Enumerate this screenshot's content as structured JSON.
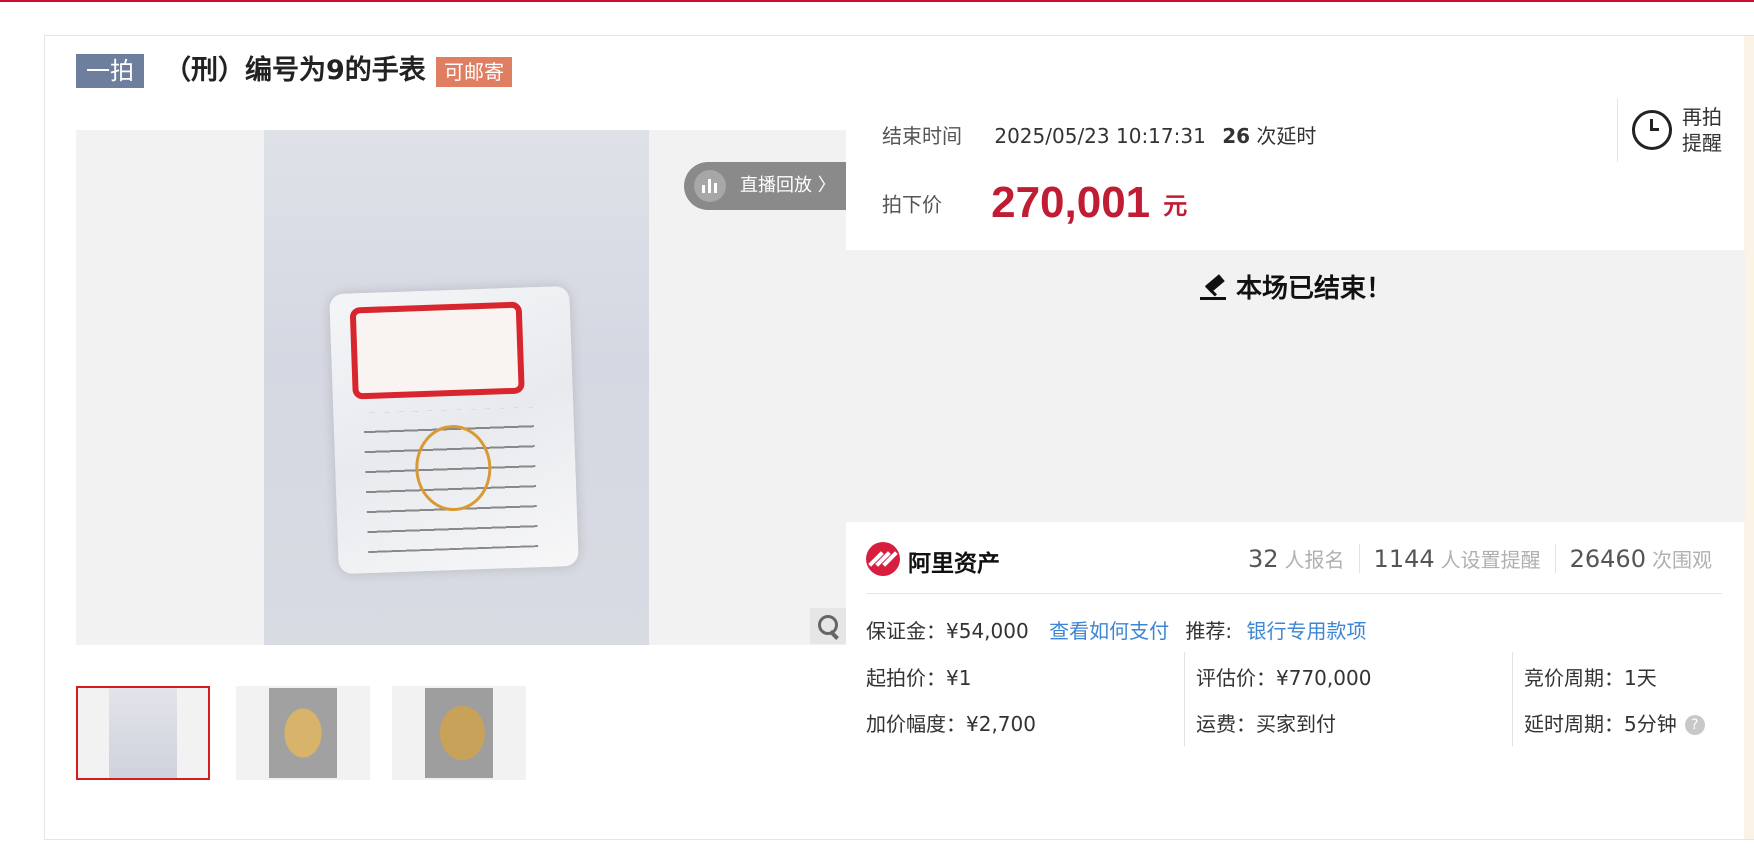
{
  "header": {
    "badge": "一拍",
    "title": "（刑）编号为9的手表",
    "tag": "可邮寄"
  },
  "gallery": {
    "replay_label": "直播回放 〉",
    "thumbnails": [
      "thumb-1",
      "thumb-2",
      "thumb-3"
    ]
  },
  "auction": {
    "end_time_label": "结束时间",
    "end_time_value": "2025/05/23 10:17:31",
    "delay_count": "26",
    "delay_label": "次延时",
    "reminder_label": "再拍提醒",
    "price_label": "拍下价",
    "price_value": "270,001",
    "price_unit": "元",
    "ended_text": "本场已结束！"
  },
  "platform": {
    "name": "阿里资产",
    "stats": [
      {
        "num": "32",
        "unit": "人报名"
      },
      {
        "num": "1144",
        "unit": "人设置提醒"
      },
      {
        "num": "26460",
        "unit": "次围观"
      }
    ]
  },
  "details": {
    "deposit": "保证金：¥54,000",
    "pay_link": "查看如何支付",
    "recommend_label": "推荐:",
    "recommend_link": "银行专用款项",
    "start_price": "起拍价：¥1",
    "increment": "加价幅度：¥2,700",
    "appraisal": "评估价：¥770,000",
    "shipping": "运费：买家到付",
    "bid_period": "竞价周期：1天",
    "delay_period": "延时周期：5分钟"
  },
  "colors": {
    "accent_red": "#c01d35",
    "badge_blue": "#6e7f9e",
    "tag_orange": "#e07e62",
    "link_blue": "#3e86d3"
  }
}
